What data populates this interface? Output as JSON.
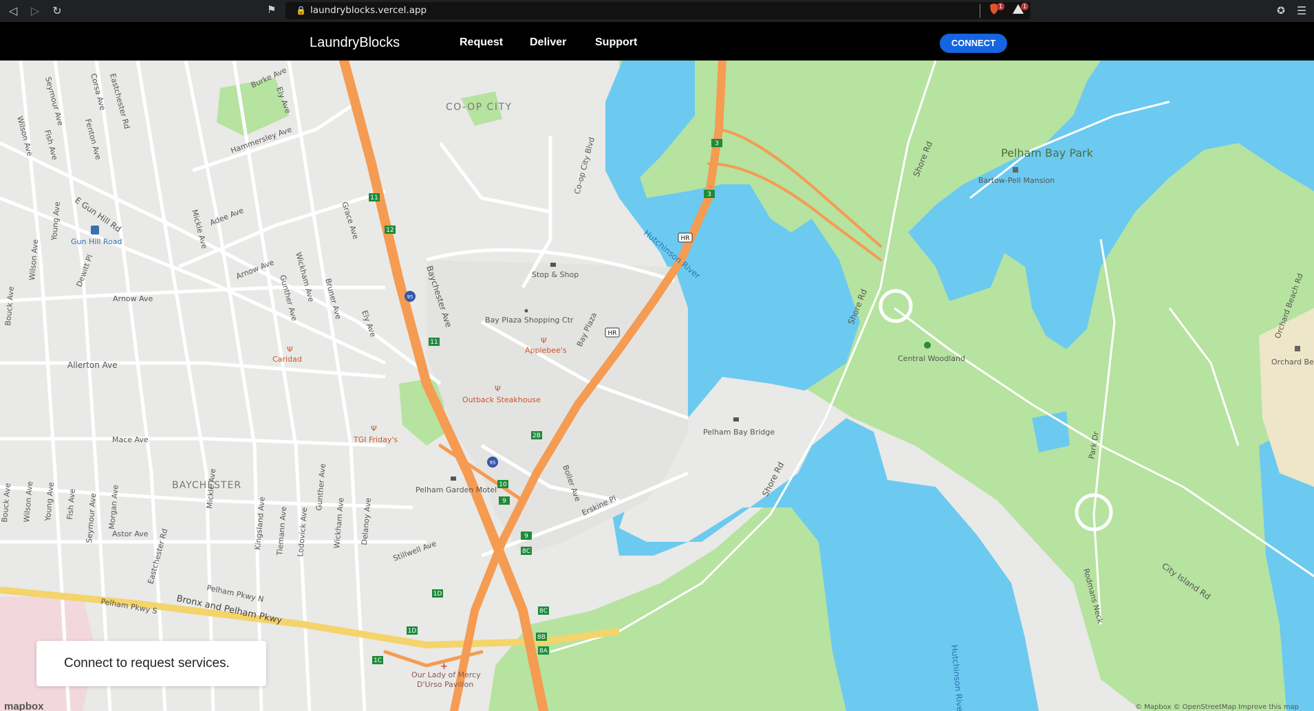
{
  "browser": {
    "url": "laundryblocks.vercel.app",
    "badge_shield": "1",
    "badge_alert": "1",
    "icons": [
      "back-icon",
      "forward-icon",
      "reload-icon",
      "bookmark-icon",
      "lock-icon",
      "brave-shield-icon",
      "alert-triangle-icon",
      "extensions-icon",
      "menu-icon"
    ]
  },
  "header": {
    "brand": "LaundryBlocks",
    "nav": [
      "Request",
      "Deliver",
      "Support"
    ],
    "connect": "CONNECT",
    "connect_color": "#1565e0"
  },
  "map": {
    "colors": {
      "water": "#6ccaf0",
      "park": "#b6e3a0",
      "land": "#e9e9e7",
      "highway": "#f59b52",
      "arterial": "#f4d46b",
      "road": "#ffffff"
    },
    "labels": {
      "co_op_city": "CO-OP CITY",
      "pelham_bay_park": "Pelham Bay Park",
      "bartow": "Bartow-Pell Mansion",
      "central_woodland": "Central Woodland",
      "orchard_beach": "Orchard Bea",
      "orchard_beach_rd": "Orchard Beach Rd",
      "hutchinson_river": "Hutchinson River",
      "hutchinson_river_2": "Hutchinson River",
      "pelham_bay_bridge": "Pelham Bay Bridge",
      "shore_rd_1": "Shore Rd",
      "shore_rd_2": "Shore Rd",
      "shore_rd_3": "Shore Rd",
      "park_dr": "Park Dr",
      "rodmans_neck": "Rodmans Neck",
      "city_island_rd": "City Island Rd",
      "stop_shop": "Stop & Shop",
      "bay_plaza": "Bay Plaza Shopping Ctr",
      "applebees": "Applebee's",
      "outback": "Outback Steakhouse",
      "tgi": "TGI Friday's",
      "caridad": "Caridad",
      "pelham_garden_motel": "Pelham Garden Motel",
      "our_lady": "Our Lady of Mercy",
      "our_lady_2": "D'Urso Pavilion",
      "baychester": "BAYCHESTER",
      "gun_hill_road": "Gun Hill Road",
      "e_gun_hill_rd": "E Gun Hill Rd",
      "allerton_ave": "Allerton Ave",
      "arnow_ave": "Arnow Ave",
      "arnow_ave_2": "Arnow Ave",
      "mace_ave": "Mace Ave",
      "astor_ave": "Astor Ave",
      "adee_ave": "Adee Ave",
      "hammersley_ave": "Hammersley Ave",
      "burke_ave": "Burke Ave",
      "ely_ave": "Ely Ave",
      "ely_ave_2": "Ely Ave",
      "grace_ave": "Grace Ave",
      "mickle_ave": "Mickle Ave",
      "mickle_ave_2": "Mickle Ave",
      "wickham_ave": "Wickham Ave",
      "wickham_ave_2": "Wickham Ave",
      "gunther_ave": "Gunther Ave",
      "gunther_ave_2": "Gunther Ave",
      "bruner_ave": "Bruner Ave",
      "baychester_ave": "Baychester Ave",
      "eastchester_rd": "Eastchester Rd",
      "eastchester_rd_2": "Eastchester Rd",
      "co_op_city_blvd": "Co-op City Blvd",
      "bay_plaza_rd": "Bay Plaza",
      "boller_ave": "Boller Ave",
      "erskine_pl": "Erskine Pl",
      "stillwell_ave": "Stillwell Ave",
      "pelham_pkwy_n": "Pelham Pkwy N",
      "pelham_pkwy_s": "Pelham Pkwy S",
      "bronx_pelham_pkwy": "Bronx and Pelham Pkwy",
      "seymour_ave": "Seymour Ave",
      "seymour_ave_2": "Seymour Ave",
      "corsa_ave": "Corsa Ave",
      "wilson_ave": "Wilson Ave",
      "wilson_ave_2": "Wilson Ave",
      "wilson_ave_3": "Wilson Ave",
      "fish_ave": "Fish Ave",
      "fish_ave_2": "Fish Ave",
      "fenton_ave": "Fenton Ave",
      "young_ave": "Young Ave",
      "young_ave_2": "Young Ave",
      "bouck_ave": "Bouck Ave",
      "bouck_ave_2": "Bouck Ave",
      "dewitt_pl": "Dewitt Pl",
      "morgan_ave": "Morgan Ave",
      "kingsland_ave": "Kingsland Ave",
      "tiemann_ave": "Tiemann Ave",
      "lodovick_ave": "Lodovick Ave",
      "delanoy_ave": "Delanoy Ave",
      "hr": "HR",
      "i95": "95"
    },
    "exits": [
      "3",
      "3",
      "11",
      "12",
      "11",
      "2B",
      "10",
      "9",
      "9",
      "8C",
      "8C",
      "8B",
      "8A",
      "1D",
      "1D",
      "1C"
    ],
    "toast": "Connect to request services.",
    "logo": "mapbox",
    "attribution": "© Mapbox © OpenStreetMap Improve this map"
  }
}
